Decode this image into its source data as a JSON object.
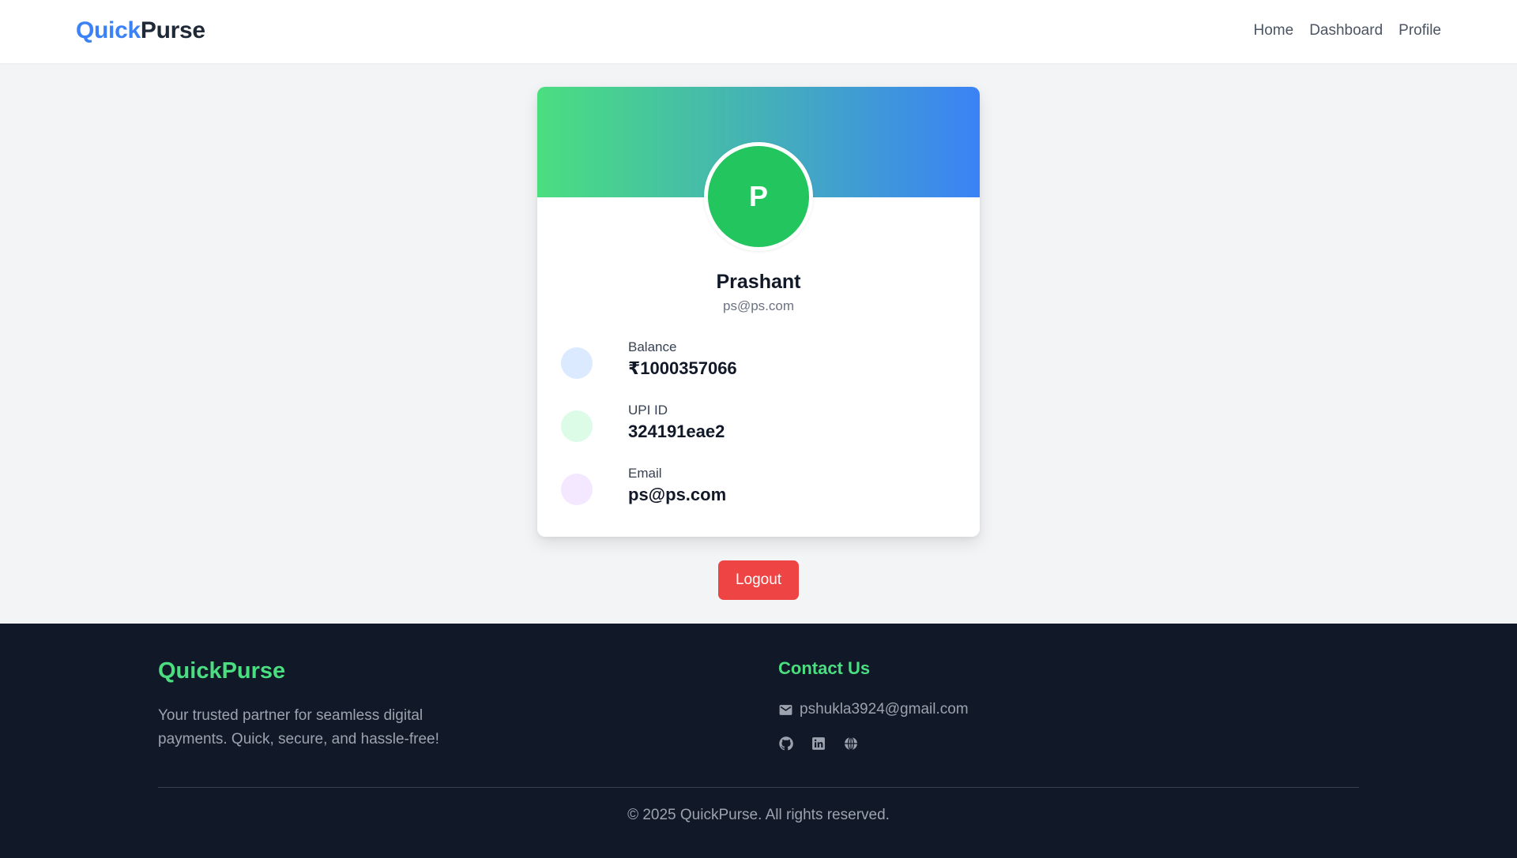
{
  "navbar": {
    "brand_part1": "Quick",
    "brand_part2": "Purse",
    "links": [
      "Home",
      "Dashboard",
      "Profile"
    ]
  },
  "profile": {
    "avatar_initial": "P",
    "name": "Prashant",
    "email": "ps@ps.com",
    "details": [
      {
        "label": "Balance",
        "value": "₹1000357066",
        "dot_color": "#dbeafe"
      },
      {
        "label": "UPI ID",
        "value": "324191eae2",
        "dot_color": "#dcfce7"
      },
      {
        "label": "Email",
        "value": "ps@ps.com",
        "dot_color": "#f3e8ff"
      }
    ],
    "logout_label": "Logout"
  },
  "footer": {
    "brand": "QuickPurse",
    "tagline": "Your trusted partner for seamless digital payments. Quick, secure, and hassle-free!",
    "contact_title": "Contact Us",
    "contact_email": "pshukla3924@gmail.com",
    "social_icons": [
      "github-icon",
      "linkedin-icon",
      "globe-icon"
    ],
    "copyright": "© 2025 QuickPurse. All rights reserved."
  },
  "colors": {
    "brand_blue": "#3b82f6",
    "brand_green": "#4ade80",
    "avatar_green": "#22c55e",
    "logout_red": "#ef4444",
    "footer_bg": "#111827"
  }
}
